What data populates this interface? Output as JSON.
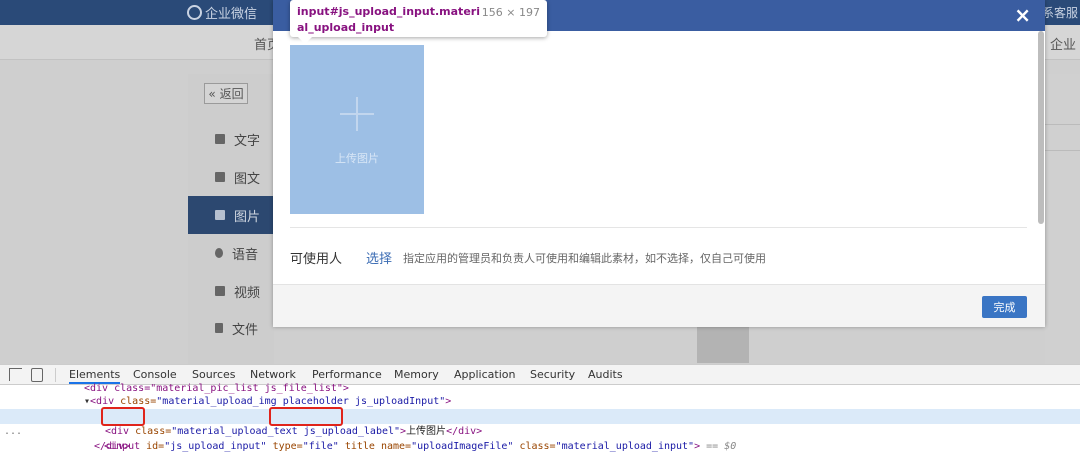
{
  "background": {
    "brand": "企业微信",
    "topbar_right": "系客服",
    "nav_home": "首页",
    "nav_right": "企业",
    "back_label": "« 返回",
    "menu": [
      {
        "label": "文字",
        "icon": "text-icon"
      },
      {
        "label": "图文",
        "icon": "article-icon"
      },
      {
        "label": "图片",
        "icon": "image-icon",
        "active": true
      },
      {
        "label": "语音",
        "icon": "voice-icon"
      },
      {
        "label": "视频",
        "icon": "video-icon"
      },
      {
        "label": "文件",
        "icon": "file-icon"
      }
    ]
  },
  "dialog": {
    "close_label": "×",
    "upload_label": "上传图片",
    "users_label": "可使用人",
    "select_link": "选择",
    "users_hint": "指定应用的管理员和负责人可使用和编辑此素材，如不选择，仅自己可使用",
    "done_label": "完成"
  },
  "tooltip": {
    "selector": "input#js_upload_input.material_upload_input",
    "size": "156 × 197"
  },
  "devtools": {
    "tabs": [
      "Elements",
      "Console",
      "Sources",
      "Network",
      "Performance",
      "Memory",
      "Application",
      "Security",
      "Audits"
    ],
    "active_tab": "Elements",
    "lines": {
      "l0": "<div class=\"material_pic_list js_file_list\">",
      "l1_tag": "<div",
      "l1_attr": " class=",
      "l1_val": "\"material_upload_img placeholder js_uploadInput\"",
      "l1_end": ">",
      "l2_tag": "<input",
      "l2_a1": " id=",
      "l2_v1": "\"js_upload_input\"",
      "l2_a2": " type=",
      "l2_v2": "\"file\"",
      "l2_a3": " title name=",
      "l2_v3": "\"uploadImageFile\"",
      "l2_a4": " class=",
      "l2_v4": "\"material_upload_input\"",
      "l2_end": ">",
      "l2_eq": " == $0",
      "l3_tag": "<div",
      "l3_attr": " class=",
      "l3_val": "\"material_upload_text js_upload_label\"",
      "l3_mid": ">",
      "l3_text": "上传图片",
      "l3_close": "</div>",
      "l4": "</div>",
      "dots": "..."
    }
  },
  "colors": {
    "highlight_box": "#e0241b",
    "overlay_upload": "#9dbfe5",
    "dialog_header": "#3a5da1"
  }
}
